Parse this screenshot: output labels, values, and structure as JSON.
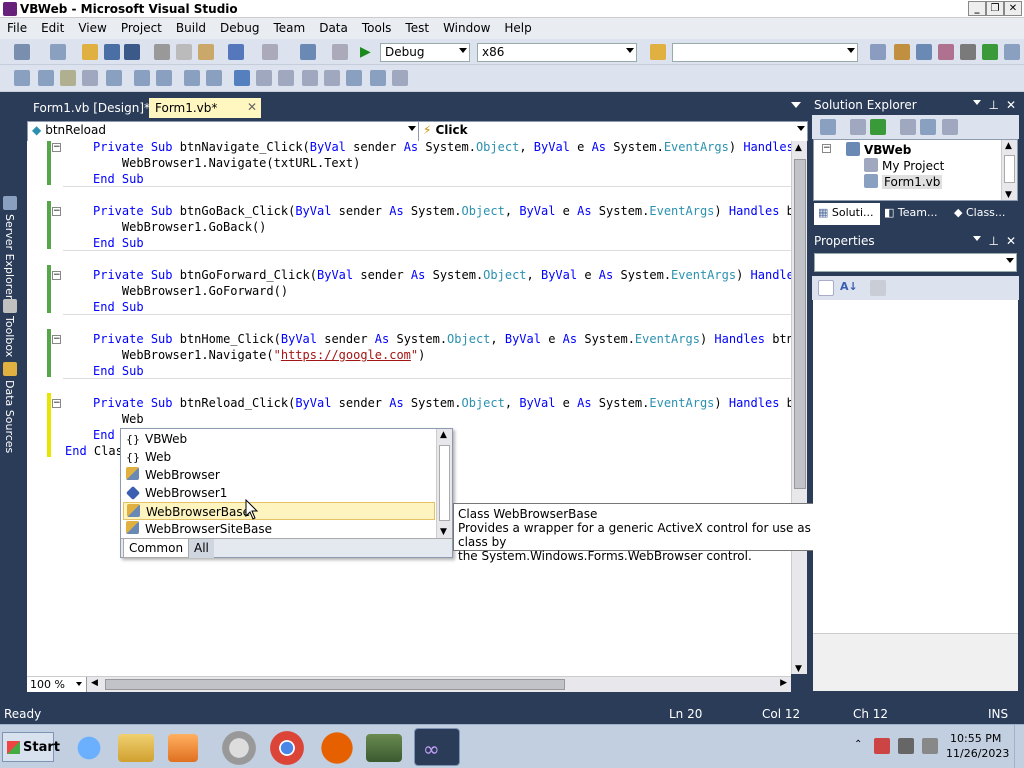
{
  "window": {
    "title": "VBWeb - Microsoft Visual Studio",
    "min": "_",
    "max": "❐",
    "close": "✕"
  },
  "menu": [
    "File",
    "Edit",
    "View",
    "Project",
    "Build",
    "Debug",
    "Team",
    "Data",
    "Tools",
    "Test",
    "Window",
    "Help"
  ],
  "toolbar": {
    "config": "Debug",
    "platform": "x86",
    "find_value": ""
  },
  "side_tabs": [
    "Server Explorer",
    "Toolbox",
    "Data Sources"
  ],
  "tabs": [
    {
      "label": "Form1.vb [Design]*",
      "active": false
    },
    {
      "label": "Form1.vb*",
      "active": true
    }
  ],
  "navbar": {
    "object": "btnReload",
    "event": "Click"
  },
  "code_lines": [
    [
      "Private Sub btnNavigate_Click(ByVal sender As System.Object, ByVal e As System.EventArgs) Handles bt"
    ],
    [
      "    WebBrowser1.Navigate(txtURL.Text)"
    ],
    [
      "End Sub"
    ],
    [
      "Private Sub btnGoBack_Click(ByVal sender As System.Object, ByVal e As System.EventArgs) Handles btnG"
    ],
    [
      "    WebBrowser1.GoBack()"
    ],
    [
      "End Sub"
    ],
    [
      "Private Sub btnGoForward_Click(ByVal sender As System.Object, ByVal e As System.EventArgs) Handles b"
    ],
    [
      "    WebBrowser1.GoForward()"
    ],
    [
      "End Sub"
    ],
    [
      "Private Sub btnHome_Click(ByVal sender As System.Object, ByVal e As System.EventArgs) Handles btnHom"
    ],
    [
      "    WebBrowser1.Navigate(\"https://google.com\")"
    ],
    [
      "End Sub"
    ],
    [
      "Private Sub btnReload_Click(ByVal sender As System.Object, ByVal e As System.EventArgs) Handles btnR"
    ],
    [
      "    Web"
    ],
    [
      "End"
    ],
    [
      "End Clas"
    ]
  ],
  "zoom": "100 %",
  "intellisense": {
    "items": [
      {
        "label": "VBWeb",
        "icon": "namespace-icon"
      },
      {
        "label": "Web",
        "icon": "namespace-icon"
      },
      {
        "label": "WebBrowser",
        "icon": "class-icon"
      },
      {
        "label": "WebBrowser1",
        "icon": "field-icon"
      },
      {
        "label": "WebBrowserBase",
        "icon": "class-icon",
        "selected": true
      },
      {
        "label": "WebBrowserSiteBase",
        "icon": "class-icon"
      }
    ],
    "tabs": [
      "Common",
      "All"
    ]
  },
  "tooltip": {
    "line1": "Class WebBrowserBase",
    "line2": "Provides a wrapper for a generic ActiveX control for use as a base class by",
    "line3": "the System.Windows.Forms.WebBrowser control."
  },
  "solution_explorer": {
    "title": "Solution Explorer",
    "root": "VBWeb",
    "items": [
      "My Project",
      "Form1.vb"
    ],
    "tabs": [
      "Soluti...",
      "Team...",
      "Class..."
    ]
  },
  "properties": {
    "title": "Properties"
  },
  "status": {
    "state": "Ready",
    "ln": "Ln 20",
    "col": "Col 12",
    "ch": "Ch 12",
    "mode": "INS"
  },
  "taskbar": {
    "start": "Start",
    "time": "10:55 PM",
    "date": "11/26/2023"
  },
  "colors": {
    "keyword": "#0000ff",
    "type": "#2b91af",
    "string": "#a31515",
    "chrome": "#2b3c59",
    "selection": "#fdf4bf"
  }
}
